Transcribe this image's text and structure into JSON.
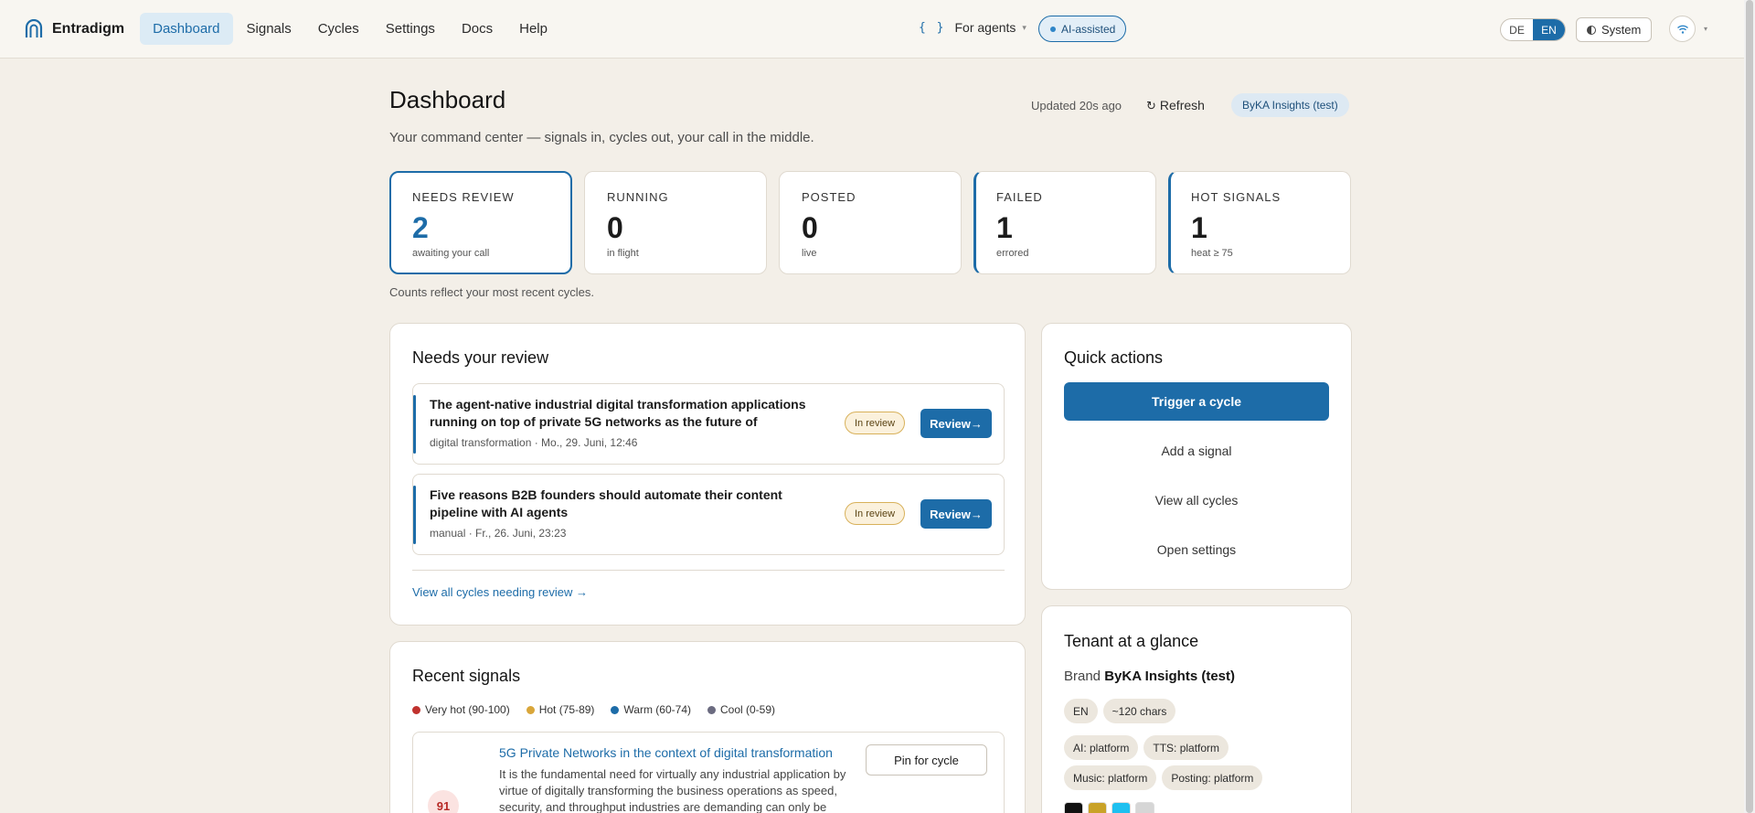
{
  "app": {
    "name": "Entradigm"
  },
  "nav": {
    "items": [
      {
        "label": "Dashboard",
        "active": true
      },
      {
        "label": "Signals"
      },
      {
        "label": "Cycles"
      },
      {
        "label": "Settings"
      },
      {
        "label": "Docs"
      },
      {
        "label": "Help"
      }
    ]
  },
  "header_controls": {
    "agents_label": "For agents",
    "ai_label": "AI-assisted",
    "lang_de": "DE",
    "lang_en": "EN",
    "theme_label": "System"
  },
  "page": {
    "title": "Dashboard",
    "updated": "Updated 20s ago",
    "refresh": "Refresh",
    "tenant": "ByKA Insights (test)",
    "subtitle": "Your command center — signals in, cycles out, your call in the middle."
  },
  "stats": [
    {
      "label": "NEEDS REVIEW",
      "value": "2",
      "sub": "awaiting your call"
    },
    {
      "label": "RUNNING",
      "value": "0",
      "sub": "in flight"
    },
    {
      "label": "POSTED",
      "value": "0",
      "sub": "live"
    },
    {
      "label": "FAILED",
      "value": "1",
      "sub": "errored"
    },
    {
      "label": "HOT SIGNALS",
      "value": "1",
      "sub": "heat ≥ 75"
    }
  ],
  "counts_note": "Counts reflect your most recent cycles.",
  "review": {
    "title": "Needs your review",
    "items": [
      {
        "title": "The agent-native industrial digital transformation applications running on top of private 5G networks as the future of industrial...",
        "meta": "digital transformation · Mo., 29. Juni, 12:46",
        "status": "In review",
        "action": "Review→"
      },
      {
        "title": "Five reasons B2B founders should automate their content pipeline with AI agents",
        "meta": "manual · Fr., 26. Juni, 23:23",
        "status": "In review",
        "action": "Review→"
      }
    ],
    "view_all": "View all cycles needing review →"
  },
  "signals": {
    "title": "Recent signals",
    "legend": [
      {
        "label": "Very hot (90-100)",
        "color": "#c0322e"
      },
      {
        "label": "Hot (75-89)",
        "color": "#d9a63a"
      },
      {
        "label": "Warm (60-74)",
        "color": "#1d6ca8"
      },
      {
        "label": "Cool (0-59)",
        "color": "#6b6b80"
      }
    ],
    "items": [
      {
        "heat": "91",
        "title": "5G Private Networks in the context of digital transformation",
        "body": "It is the fundamental need for virtually any industrial application by virtue of digitally transforming the business operations as speed, security, and throughput industries are demanding can only be",
        "action": "Pin for cycle"
      }
    ]
  },
  "quick_actions": {
    "title": "Quick actions",
    "primary": "Trigger a cycle",
    "items": [
      "Add a signal",
      "View all cycles",
      "Open settings"
    ]
  },
  "tenant": {
    "title": "Tenant at a glance",
    "brand_label": "Brand",
    "brand_name": "ByKA Insights (test)",
    "chips_row1": [
      "EN",
      "~120 chars"
    ],
    "chips_row2": [
      "AI: platform",
      "TTS: platform"
    ],
    "chips_row3": [
      "Music: platform",
      "Posting: platform"
    ],
    "swatches": [
      "#111111",
      "#c9a227",
      "#1ec0f0",
      "#d6d6d6"
    ]
  },
  "colors": {
    "accent": "#1d6ca8",
    "background": "#f3efe8"
  }
}
